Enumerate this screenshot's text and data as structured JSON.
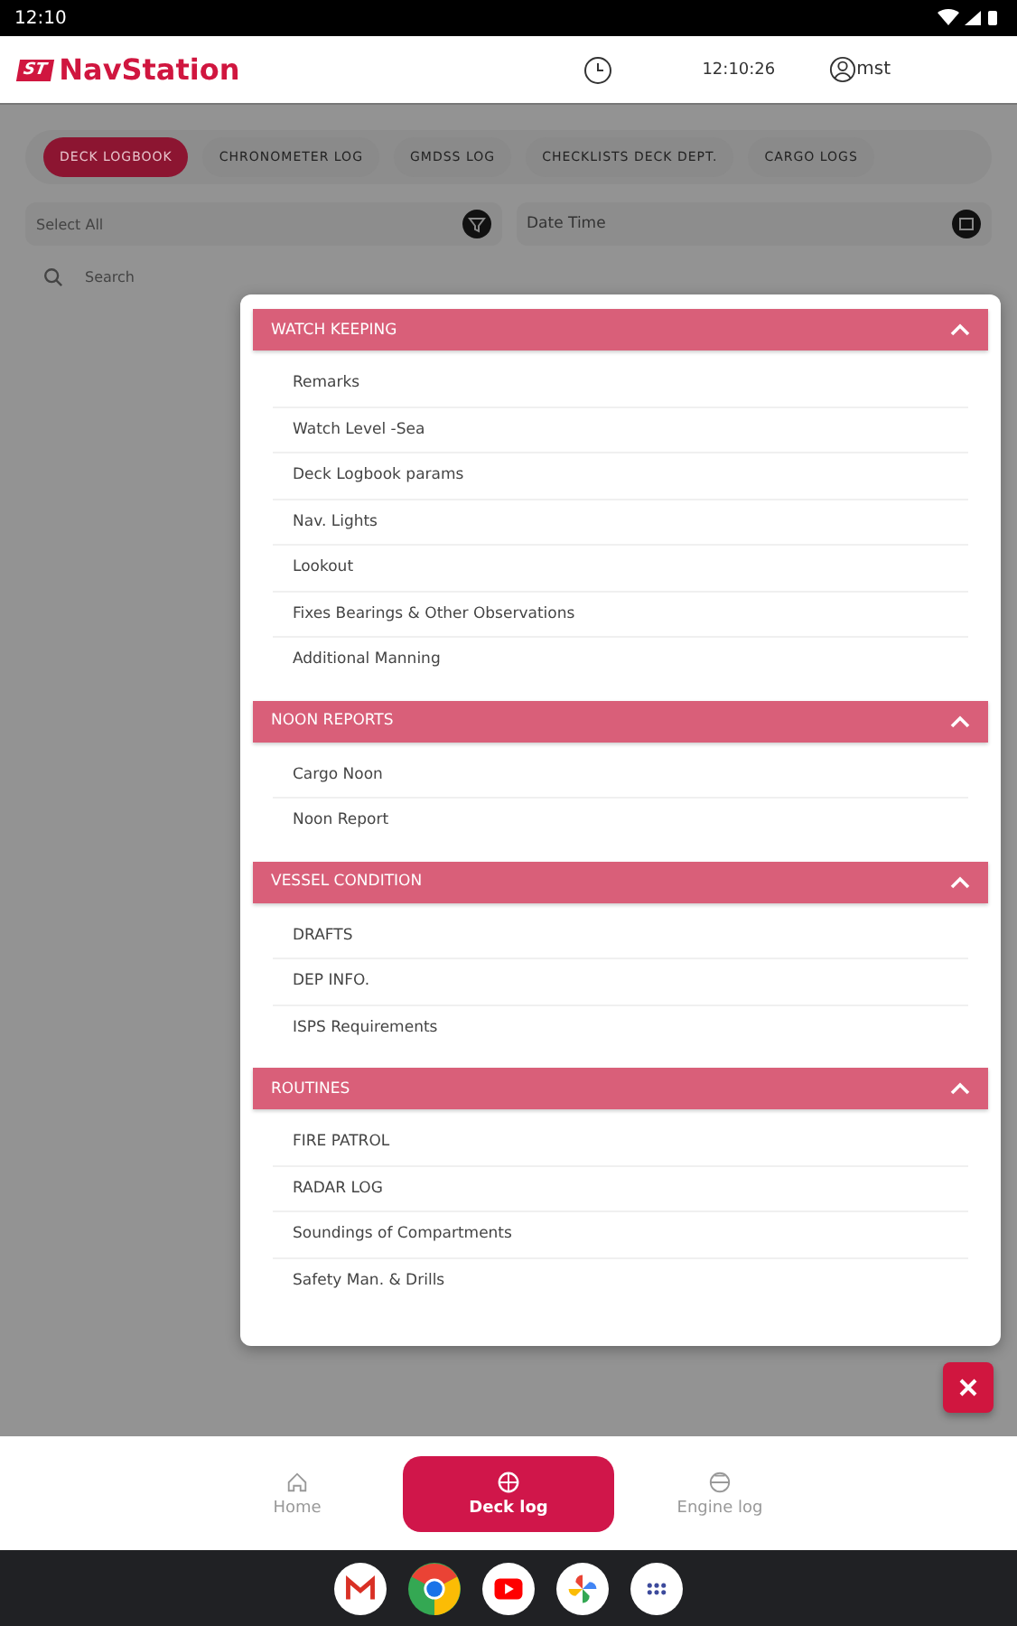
{
  "status_bar": {
    "time": "12:10"
  },
  "header": {
    "logo_mark": "ST",
    "logo_text": "NavStation",
    "clock": "12:10:26",
    "user": "mst"
  },
  "tabs": [
    {
      "label": "DECK LOGBOOK",
      "selected": true
    },
    {
      "label": "CHRONOMETER LOG",
      "selected": false
    },
    {
      "label": "GMDSS LOG",
      "selected": false
    },
    {
      "label": "CHECKLISTS DECK DEPT.",
      "selected": false
    },
    {
      "label": "CARGO LOGS",
      "selected": false
    }
  ],
  "filters": {
    "select": {
      "placeholder": "Select All"
    },
    "date": {
      "value": "Date Time"
    }
  },
  "search": {
    "placeholder": "Search"
  },
  "menu": {
    "sections": [
      {
        "title": "WATCH KEEPING",
        "expanded": true,
        "items": [
          "Remarks",
          "Watch Level -Sea",
          "Deck Logbook params",
          "Nav. Lights",
          "Lookout",
          "Fixes Bearings & Other Observations",
          "Additional Manning"
        ]
      },
      {
        "title": "NOON REPORTS",
        "expanded": true,
        "items": [
          "Cargo Noon",
          "Noon Report"
        ]
      },
      {
        "title": "VESSEL CONDITION",
        "expanded": true,
        "items": [
          "DRAFTS",
          "DEP INFO.",
          "ISPS Requirements"
        ]
      },
      {
        "title": "ROUTINES",
        "expanded": true,
        "items": [
          "FIRE PATROL",
          "RADAR LOG",
          "Soundings of Compartments",
          "Safety Man. & Drills"
        ]
      }
    ]
  },
  "bottom_nav": [
    {
      "label": "Home",
      "kind": "home",
      "selected": false
    },
    {
      "label": "Deck log",
      "kind": "deck",
      "selected": true
    },
    {
      "label": "Engine log",
      "kind": "engine",
      "selected": false
    }
  ],
  "dock": [
    {
      "kind": "mail"
    },
    {
      "kind": "browser"
    },
    {
      "kind": "video"
    },
    {
      "kind": "photos"
    },
    {
      "kind": "apps"
    }
  ]
}
